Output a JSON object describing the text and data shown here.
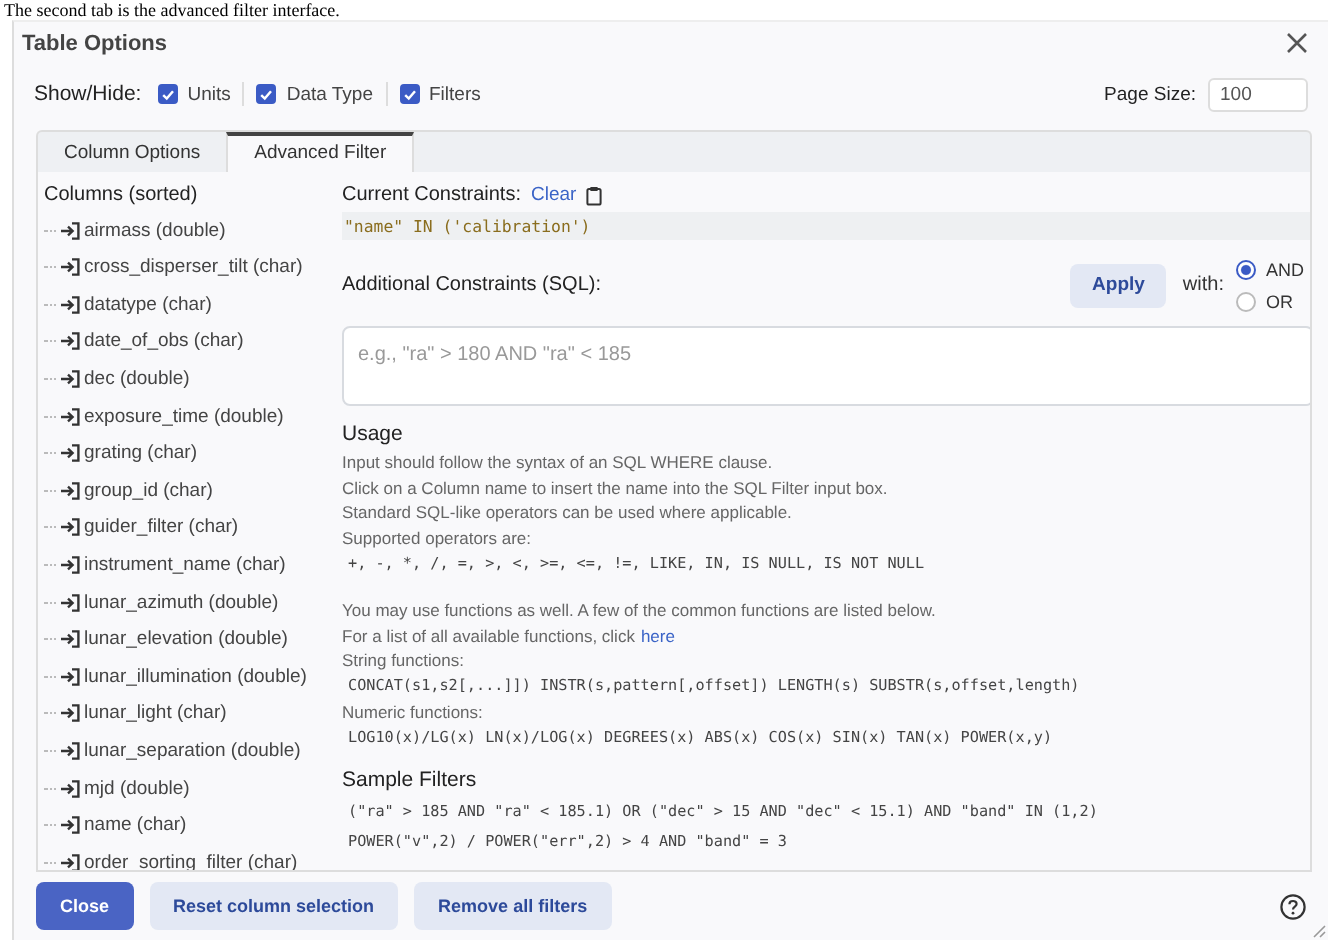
{
  "caption": "The second tab is the advanced filter interface.",
  "dialog": {
    "title": "Table Options"
  },
  "show_hide": {
    "label": "Show/Hide:",
    "options": [
      {
        "label": "Units",
        "checked": true
      },
      {
        "label": "Data Type",
        "checked": true
      },
      {
        "label": "Filters",
        "checked": true
      }
    ]
  },
  "page_size": {
    "label": "Page Size:",
    "value": "100"
  },
  "tabs": [
    {
      "label": "Column Options",
      "selected": false
    },
    {
      "label": "Advanced Filter",
      "selected": true
    }
  ],
  "columns": {
    "title": "Columns (sorted)",
    "items": [
      "airmass (double)",
      "cross_disperser_tilt (char)",
      "datatype (char)",
      "date_of_obs (char)",
      "dec (double)",
      "exposure_time (double)",
      "grating (char)",
      "group_id (char)",
      "guider_filter (char)",
      "instrument_name (char)",
      "lunar_azimuth (double)",
      "lunar_elevation (double)",
      "lunar_illumination (double)",
      "lunar_light (char)",
      "lunar_separation (double)",
      "mjd (double)",
      "name (char)",
      "order_sorting_filter (char)"
    ]
  },
  "current": {
    "label": "Current Constraints:",
    "clear": "Clear",
    "value": "\"name\" IN ('calibration')"
  },
  "additional": {
    "label": "Additional Constraints (SQL):",
    "apply": "Apply",
    "with_label": "with:",
    "options": [
      {
        "label": "AND",
        "selected": true
      },
      {
        "label": "OR",
        "selected": false
      }
    ],
    "placeholder": "e.g., \"ra\" > 180 AND \"ra\" < 185"
  },
  "usage": {
    "title": "Usage",
    "lines": [
      {
        "kind": "text",
        "text": "Input should follow the syntax of an SQL WHERE clause."
      },
      {
        "kind": "text",
        "text": "Click on a Column name to insert the name into the SQL Filter input box."
      },
      {
        "kind": "text",
        "text": "Standard SQL-like operators can be used where applicable."
      },
      {
        "kind": "text",
        "text": "Supported operators are:"
      },
      {
        "kind": "code",
        "text": "+, -, *, /, =, >, <, >=, <=, !=, LIKE, IN, IS NULL, IS NOT NULL"
      },
      {
        "kind": "gap"
      },
      {
        "kind": "text",
        "text": "You may use functions as well. A few of the common functions are listed below."
      },
      {
        "kind": "link",
        "text": "For a list of all available functions, click",
        "link": "here"
      },
      {
        "kind": "text",
        "text": "String functions:"
      },
      {
        "kind": "code",
        "text": "CONCAT(s1,s2[,...]]) INSTR(s,pattern[,offset]) LENGTH(s) SUBSTR(s,offset,length)"
      },
      {
        "kind": "text",
        "text": "Numeric functions:"
      },
      {
        "kind": "code",
        "text": "LOG10(x)/LG(x) LN(x)/LOG(x) DEGREES(x) ABS(x) COS(x) SIN(x) TAN(x) POWER(x,y)"
      }
    ]
  },
  "samples": {
    "title": "Sample Filters",
    "lines": [
      "(\"ra\" > 185 AND \"ra\" < 185.1) OR (\"dec\" > 15 AND \"dec\" < 15.1) AND \"band\" IN (1,2)",
      "POWER(\"v\",2) / POWER(\"err\",2) > 4 AND \"band\" = 3"
    ]
  },
  "footer": {
    "buttons": [
      {
        "label": "Close",
        "kind": "primary"
      },
      {
        "label": "Reset column selection",
        "kind": "secondary"
      },
      {
        "label": "Remove all filters",
        "kind": "secondary"
      }
    ]
  }
}
